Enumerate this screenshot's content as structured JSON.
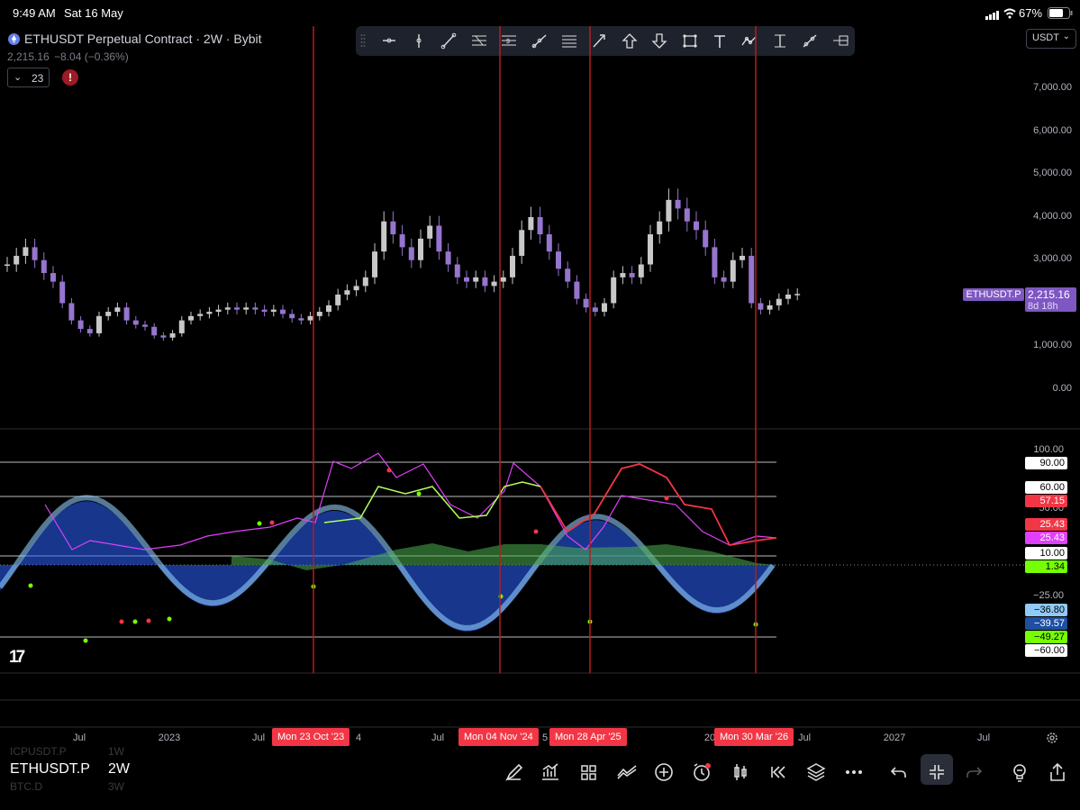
{
  "status": {
    "time": "9:49 AM",
    "date": "Sat 16 May",
    "battery": "67%"
  },
  "symbol": {
    "title": "ETHUSDT Perpetual Contract · 2W · Bybit",
    "price": "2,215.16",
    "change": "−8.04 (−0.36%)",
    "interval_count": "23",
    "alert": "!"
  },
  "toolbar": {
    "tools": [
      "horizontal-ray-icon",
      "vertical-line-icon",
      "trend-line-icon",
      "fib-retracement-icon",
      "price-range-icon",
      "parallel-channel-icon",
      "pitchfork-icon",
      "arrow-icon",
      "arrow-up-icon",
      "arrow-down-icon",
      "rectangle-icon",
      "text-icon",
      "path-icon",
      "date-range-icon",
      "ray-icon",
      "long-position-icon"
    ]
  },
  "currency": "USDT",
  "price_axis": [
    "7,000.00",
    "6,000.00",
    "5,000.00",
    "4,000.00",
    "3,000.00",
    "1,000.00",
    "0.00"
  ],
  "price_tag": {
    "symbol": "ETHUSDT.P",
    "value": "2,215.16",
    "countdown": "8d 18h"
  },
  "osc_axis": [
    "100.00",
    "50.00",
    "−25.00"
  ],
  "osc_tags": [
    {
      "value": "90.00",
      "bg": "#ffffff",
      "fg": "#000000"
    },
    {
      "value": "60.00",
      "bg": "#ffffff",
      "fg": "#000000"
    },
    {
      "value": "57.15",
      "bg": "#f23645",
      "fg": "#ffffff"
    },
    {
      "value": "25.43",
      "bg": "#f23645",
      "fg": "#ffffff"
    },
    {
      "value": "25.43",
      "bg": "#e040fb",
      "fg": "#ffffff"
    },
    {
      "value": "10.00",
      "bg": "#ffffff",
      "fg": "#000000"
    },
    {
      "value": "1.34",
      "bg": "#76ff03",
      "fg": "#000000"
    },
    {
      "value": "−36.80",
      "bg": "#90caf9",
      "fg": "#000000"
    },
    {
      "value": "−39.57",
      "bg": "#1e4fa3",
      "fg": "#ffffff"
    },
    {
      "value": "−49.27",
      "bg": "#76ff03",
      "fg": "#000000"
    },
    {
      "value": "−60.00",
      "bg": "#ffffff",
      "fg": "#000000"
    }
  ],
  "x_axis": [
    "Jul",
    "2023",
    "Jul",
    "4",
    "Jul",
    "5",
    "20",
    "Jul",
    "2027",
    "Jul"
  ],
  "date_tags": [
    "Mon 23 Oct '23",
    "Mon 04 Nov '24",
    "Mon 28 Apr '25",
    "Mon 30 Mar '26"
  ],
  "bottom": {
    "symbol": "ETHUSDT.P",
    "interval": "2W",
    "ghost_symbols": [
      {
        "symbol": "ICPUSDT.P",
        "interval": "1W"
      },
      {
        "symbol": "BTC.D",
        "interval": "3W"
      }
    ],
    "icons": [
      "draw-icon",
      "indicators-icon",
      "layouts-icon",
      "compare-icon",
      "add-icon",
      "alert-icon",
      "chart-type-icon",
      "replay-icon",
      "layers-icon",
      "more-icon",
      "undo-icon",
      "fullscreen-exit-icon",
      "redo-icon",
      "ideas-icon",
      "share-icon"
    ]
  },
  "watermark": "17",
  "colors": {
    "up": "#c8c8c8",
    "down": "#9575cd",
    "accent": "#f23645",
    "background": "#000000"
  }
}
